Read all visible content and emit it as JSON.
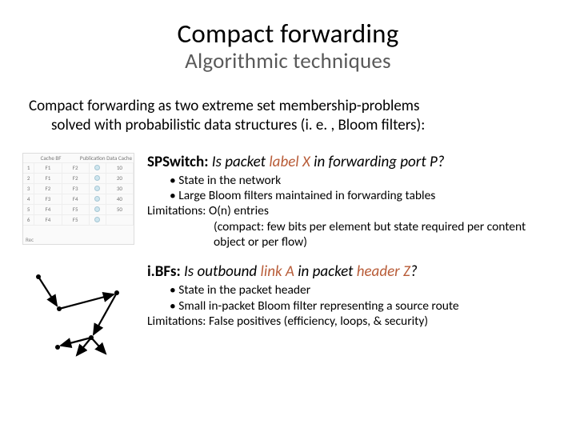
{
  "title": "Compact forwarding",
  "subtitle": "Algorithmic techniques",
  "intro_line1": "Compact forwarding as two extreme set membership-problems",
  "intro_line2": "solved with probabilistic data structures (i. e. , Bloom filters):",
  "fig1": {
    "hdr_left": "Cache BF",
    "hdr_right": "Publication Data Cache",
    "col_idx": [
      "1",
      "2",
      "3",
      "4",
      "5",
      "6"
    ],
    "col_a": [
      "F1",
      "F1",
      "F2",
      "F3",
      "F4",
      "F4"
    ],
    "col_b": [
      "F2",
      "F2",
      "F3",
      "F4",
      "F5",
      "F5"
    ],
    "ports": [
      "10",
      "20",
      "30",
      "40",
      "50"
    ],
    "bot_label": "Rec"
  },
  "spswitch": {
    "lead": "SPSwitch:",
    "q_pre": " Is packet ",
    "q_hl": "label X",
    "q_post": " in forwarding port P?",
    "b1": "• State in the network",
    "b2": "• Large Bloom filters maintained in forwarding tables",
    "lim_label": "Limitations:",
    "lim_text": "  O(n) entries",
    "lim_detail": "(compact: few bits per element but state required per content object  or per flow)"
  },
  "ibfs": {
    "lead": "i.BFs:",
    "q_pre": " Is outbound ",
    "q_hl": "link A",
    "q_mid": " in packet ",
    "q_hl2": "header Z",
    "q_post": "?",
    "b1": "• State in the packet header",
    "b2": "• Small in-packet Bloom filter representing a source route",
    "lim_label": "Limitations:",
    "lim_text": " False positives (efficiency, loops, & security)"
  }
}
